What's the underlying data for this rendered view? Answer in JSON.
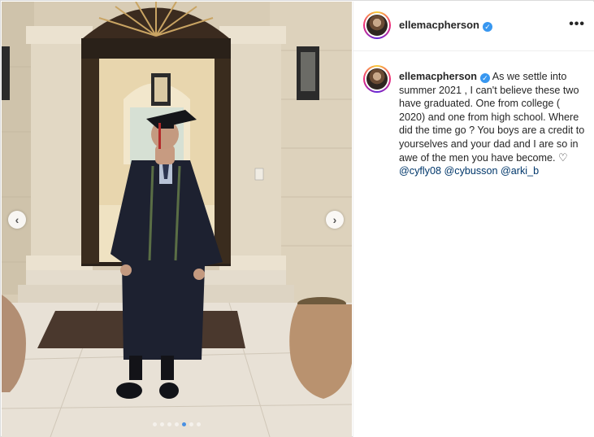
{
  "post": {
    "username": "ellemacpherson",
    "verified_symbol": "✓",
    "more_symbol": "•••",
    "caption_text_1": "As we settle into summer 2021 , I can't believe these two have graduated. One from college ( 2020) and one from high school. Where did the time go ? You boys are a credit to yourselves and your dad and I are so in awe of the men you have become.",
    "heart_symbol": "♡",
    "mentions": [
      "@cyfly08",
      "@cybusson",
      "@arki_b"
    ]
  },
  "carousel": {
    "prev_symbol": "‹",
    "next_symbol": "›",
    "slide_count": 7,
    "active_index": 4
  },
  "colors": {
    "link": "#00376b",
    "verified": "#3897f0",
    "active_dot": "#4a90e2"
  }
}
